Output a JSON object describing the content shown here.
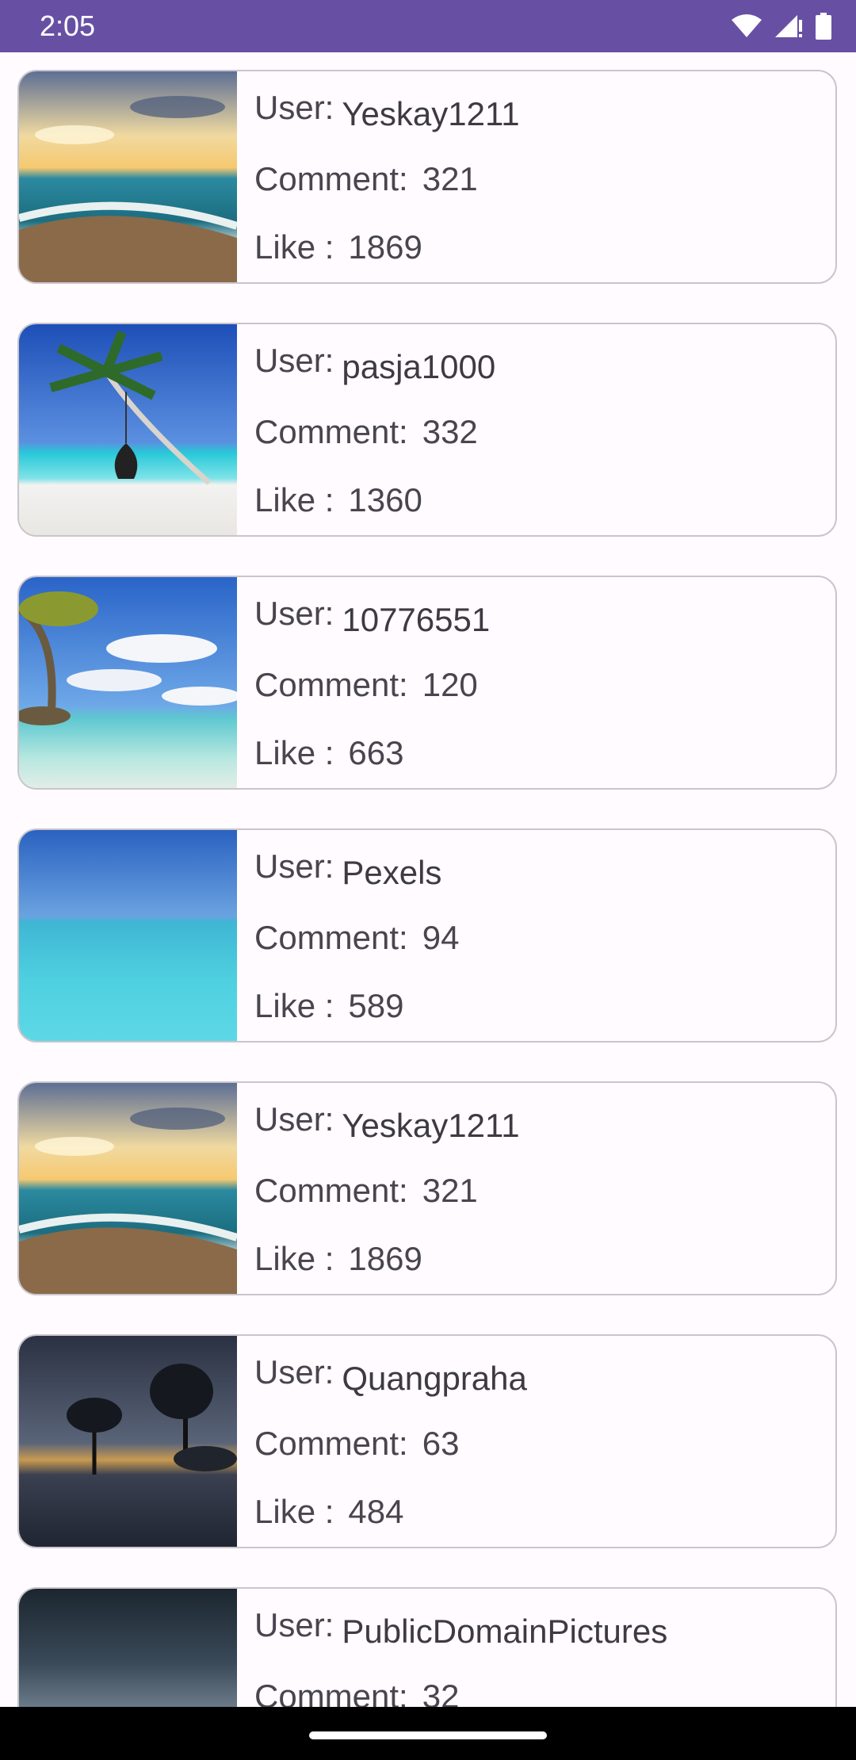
{
  "status_bar": {
    "time": "2:05",
    "icons": [
      "wifi-icon",
      "cell-signal-icon",
      "battery-icon"
    ]
  },
  "labels": {
    "user": "User:",
    "comment": "Comment:",
    "like": "Like :"
  },
  "posts": [
    {
      "user": "Yeskay1211",
      "comments": "321",
      "likes": "1869",
      "image": "sunset-beach-waves"
    },
    {
      "user": "pasja1000",
      "comments": "332",
      "likes": "1360",
      "image": "palm-tree-swing-beach"
    },
    {
      "user": "10776551",
      "comments": "120",
      "likes": "663",
      "image": "tree-clouds-beach"
    },
    {
      "user": "Pexels",
      "comments": "94",
      "likes": "589",
      "image": "turquoise-sea-horizon"
    },
    {
      "user": "Yeskay1211",
      "comments": "321",
      "likes": "1869",
      "image": "sunset-beach-waves"
    },
    {
      "user": "Quangpraha",
      "comments": "63",
      "likes": "484",
      "image": "trees-in-water-sunset"
    },
    {
      "user": "PublicDomainPictures",
      "comments": "32",
      "likes": "",
      "image": "stormy-sea"
    }
  ],
  "colors": {
    "status_bar": "#6750a4",
    "card_border": "#c9c5cc",
    "text": "#49454f",
    "background": "#fffbfe"
  }
}
